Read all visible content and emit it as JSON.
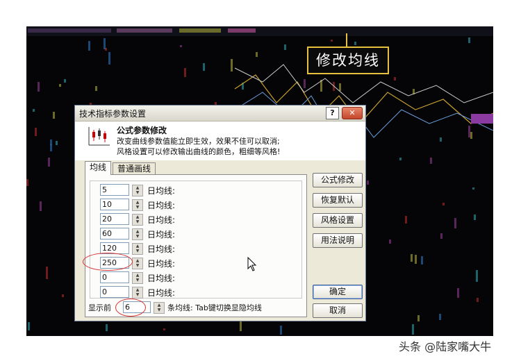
{
  "callout": {
    "label": "均线",
    "text": "修改均线"
  },
  "dialog": {
    "title": "技术指标参数设置",
    "help_label": "?",
    "close_label": "✕",
    "header": {
      "title": "公式参数修改",
      "line1": "改变曲线参数值能立即生效，效果不佳可以取消;",
      "line2": "风格设置可以修改输出曲线的颜色，粗细等风格!"
    },
    "tabs": [
      {
        "label": "均线"
      },
      {
        "label": "普通画线"
      }
    ],
    "params": [
      {
        "value": "5",
        "label": "日均线:"
      },
      {
        "value": "10",
        "label": "日均线:"
      },
      {
        "value": "20",
        "label": "日均线:"
      },
      {
        "value": "60",
        "label": "日均线:"
      },
      {
        "value": "120",
        "label": "日均线:"
      },
      {
        "value": "250",
        "label": "日均线:"
      },
      {
        "value": "0",
        "label": "日均线:"
      },
      {
        "value": "0",
        "label": "日均线:"
      }
    ],
    "display": {
      "prefix": "显示前",
      "count": "6",
      "suffix": "条均线:  Tab键切换显隐均线"
    },
    "buttons": {
      "formula_edit": "公式修改",
      "restore_default": "恢复默认",
      "style_settings": "风格设置",
      "usage_notes": "用法说明",
      "ok": "确定",
      "cancel": "取消"
    }
  },
  "watermark": "头条 @陆家嘴大牛",
  "colors": {
    "callout_border": "#e8c040",
    "highlight_oval": "#d93030",
    "dialog_bg": "#ece9d8"
  }
}
